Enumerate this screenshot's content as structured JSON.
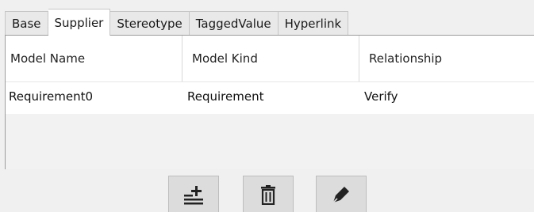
{
  "tabs": [
    {
      "label": "Base",
      "active": false
    },
    {
      "label": "Supplier",
      "active": true
    },
    {
      "label": "Stereotype",
      "active": false
    },
    {
      "label": "TaggedValue",
      "active": false
    },
    {
      "label": "Hyperlink",
      "active": false
    }
  ],
  "table": {
    "columns": [
      "Model Name",
      "Model Kind",
      "Relationship"
    ],
    "rows": [
      {
        "model_name": "Requirement0",
        "model_kind": "Requirement",
        "relationship": "Verify"
      }
    ]
  },
  "toolbar": {
    "buttons": [
      {
        "icon": "add-list-icon"
      },
      {
        "icon": "trash-icon"
      },
      {
        "icon": "pen-edit-icon"
      }
    ]
  }
}
